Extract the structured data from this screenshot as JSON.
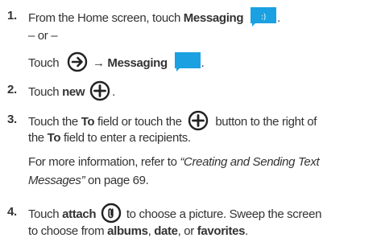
{
  "steps": [
    {
      "number": "1.",
      "text_a": "From the Home screen, touch ",
      "bold_a": "Messaging",
      "text_b": ".",
      "or": "– or –",
      "touch": "Touch",
      "arrow": "→",
      "bold_b": "Messaging",
      "text_c": "."
    },
    {
      "number": "2.",
      "text_a": "Touch ",
      "bold_a": "new",
      "text_b": "."
    },
    {
      "number": "3.",
      "line1_a": "Touch the ",
      "line1_bold": "To",
      "line1_b": " field or touch the",
      "line1_c": "button to the right of",
      "line2_a": "the ",
      "line2_bold": "To",
      "line2_b": " field to enter a recipients.",
      "line3_a": "For more information, refer to ",
      "line3_italic": "“Creating and Sending Text",
      "line4_italic": "Messages”",
      "line4_b": " on page 69."
    },
    {
      "number": "4.",
      "line1_a": "Touch ",
      "line1_bold": "attach",
      "line1_b": "to choose a picture. Sweep the screen",
      "line2_a": "to choose from ",
      "line2_bold_a": "albums",
      "line2_b": ", ",
      "line2_bold_b": "date",
      "line2_c": ", or ",
      "line2_bold_c": "favorites",
      "line2_d": "."
    }
  ],
  "colors": {
    "text": "#333333",
    "messaging_icon_bg": "#1ba1e2",
    "messaging_icon_2_bg": "#1ba1e2",
    "circle_icon": "#222222"
  },
  "icons": [
    "messaging-smiley-icon",
    "arrow-circle-icon",
    "messaging-blank-icon",
    "plus-circle-icon",
    "attach-paperclip-icon"
  ]
}
